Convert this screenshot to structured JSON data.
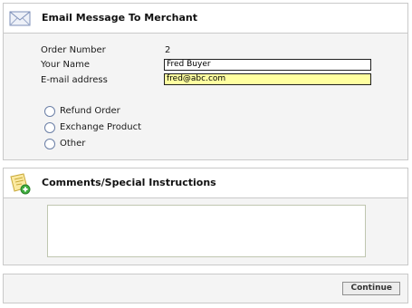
{
  "email_panel": {
    "title": "Email Message To Merchant",
    "icon": "envelope-icon",
    "order_number_label": "Order Number",
    "order_number_value": "2",
    "your_name_label": "Your Name",
    "your_name_value": "Fred Buyer",
    "email_label": "E-mail address",
    "email_value": "fred@abc.com",
    "options": [
      {
        "label": "Refund Order",
        "selected": false
      },
      {
        "label": "Exchange Product",
        "selected": false
      },
      {
        "label": "Other",
        "selected": false
      }
    ]
  },
  "comments_panel": {
    "title": "Comments/Special Instructions",
    "icon": "note-add-icon",
    "value": ""
  },
  "actions": {
    "continue_label": "Continue"
  },
  "colors": {
    "panel_border": "#c9c9c9",
    "panel_body": "#f4f4f4",
    "email_field_highlight": "#ffffa0",
    "radio_border": "#6b7fa6"
  }
}
